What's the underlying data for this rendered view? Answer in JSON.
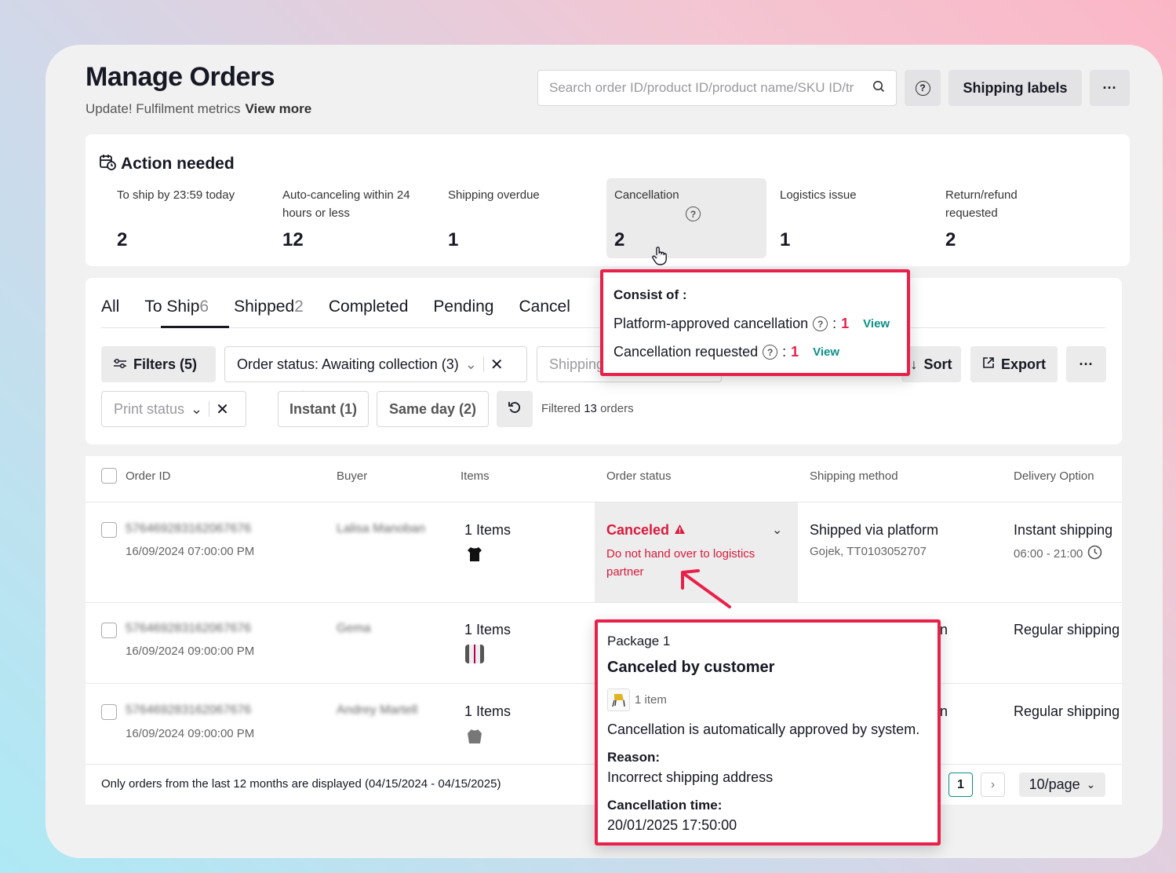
{
  "header": {
    "title": "Manage Orders",
    "subtitle": "Update! Fulfilment metrics",
    "view_more": "View more",
    "search_placeholder": "Search order ID/product ID/product name/SKU ID/tr",
    "help_icon": "?",
    "shipping_labels": "Shipping labels",
    "more": "···"
  },
  "action_needed": {
    "title": "Action needed",
    "metrics": [
      {
        "label": "To ship by 23:59 today",
        "value": "2"
      },
      {
        "label": "Auto-canceling within 24 hours or less",
        "value": "12"
      },
      {
        "label": "Shipping overdue",
        "value": "1"
      },
      {
        "label": "Cancellation",
        "value": "2"
      },
      {
        "label": "Logistics issue",
        "value": "1"
      },
      {
        "label": "Return/refund requested",
        "value": "2"
      }
    ]
  },
  "tabs": [
    {
      "label": "All",
      "count": ""
    },
    {
      "label": "To Ship",
      "count": "6"
    },
    {
      "label": "Shipped",
      "count": "2"
    },
    {
      "label": "Completed",
      "count": ""
    },
    {
      "label": "Pending",
      "count": ""
    },
    {
      "label": "Cancel",
      "count": ""
    }
  ],
  "filters": {
    "filters_btn": "Filters (5)",
    "order_status": "Order status: Awaiting collection (3)",
    "shipping_placeholder": "Shipping",
    "sort": "Sort",
    "export": "Export",
    "more": "···",
    "print_status": "Print status",
    "instant": "Instant (1)",
    "same_day": "Same day (2)",
    "filtered_prefix": "Filtered",
    "filtered_count": "13",
    "filtered_suffix": "orders"
  },
  "table": {
    "headers": [
      "Order ID",
      "Buyer",
      "Items",
      "Order status",
      "Shipping method",
      "Delivery Option"
    ],
    "rows": [
      {
        "order_id": "576469283162067676",
        "date": "16/09/2024 07:00:00 PM",
        "buyer": "Lalisa Manoban",
        "items": "1 Items",
        "status": "Canceled",
        "status_sub": "Do not hand over to logistics partner",
        "ship_method": "Shipped via platform",
        "ship_sub": "Gojek, TT0103052707",
        "delivery": "Instant shipping",
        "delivery_sub": "06:00 - 21:00"
      },
      {
        "order_id": "576469283162067676",
        "date": "16/09/2024 09:00:00 PM",
        "buyer": "Gema",
        "items": "1 Items",
        "ship_method_tail": "n",
        "delivery": "Regular shipping"
      },
      {
        "order_id": "576469283162067676",
        "date": "16/09/2024 09:00:00 PM",
        "buyer": "Andrey Martell",
        "items": "1 Items",
        "ship_method_tail": "n",
        "delivery": "Regular shipping"
      }
    ],
    "footer_note": "Only orders from the last 12 months are displayed (04/15/2024 - 04/15/2025)",
    "page": "1",
    "page_size": "10/page"
  },
  "popover_cancellation": {
    "title": "Consist of :",
    "line1": "Platform-approved cancellation",
    "line1_count": "1",
    "line2": "Cancellation requested",
    "line2_count": "1",
    "view": "View",
    "colon": ":"
  },
  "popover_package": {
    "package": "Package 1",
    "title": "Canceled by customer",
    "item_count": "1 item",
    "auto_note": "Cancellation is automatically approved by system.",
    "reason_label": "Reason:",
    "reason": "Incorrect shipping address",
    "time_label": "Cancellation time:",
    "time": "20/01/2025 17:50:00"
  },
  "colors": {
    "accent_red": "#e8204a",
    "link_green": "#0d8f8a",
    "danger": "#d91a3a"
  }
}
